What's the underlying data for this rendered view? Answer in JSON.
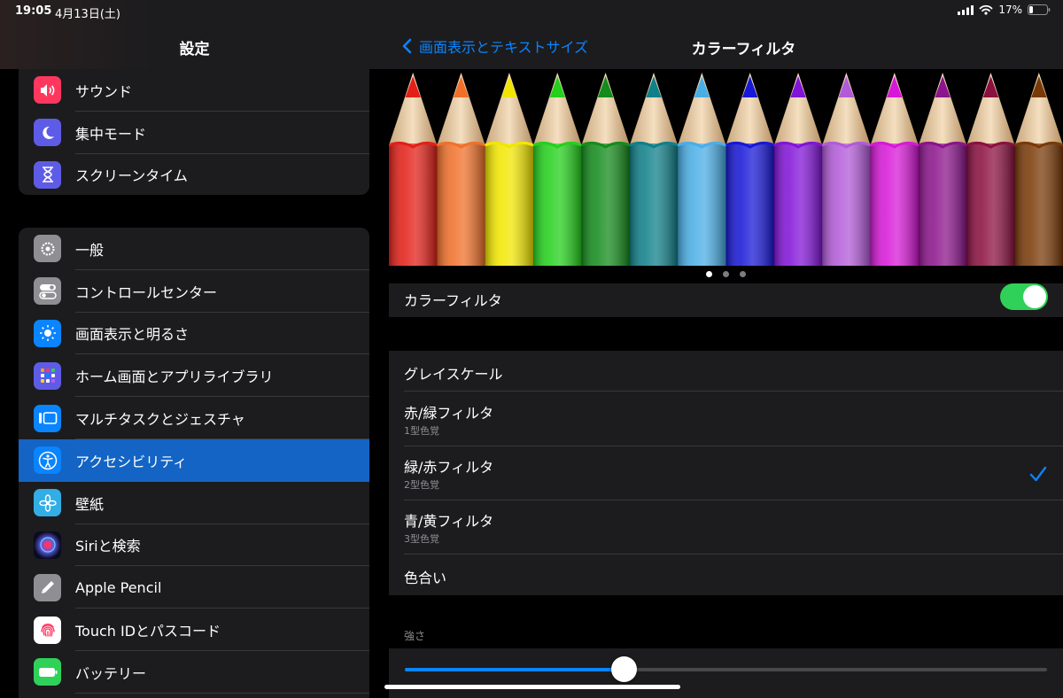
{
  "status": {
    "time": "19:05",
    "date": "4月13日(土)",
    "battery": "17%"
  },
  "sidebar": {
    "title": "設定",
    "group1": [
      {
        "label": "サウンド",
        "icon": "speaker-icon",
        "color": "#ff375f"
      },
      {
        "label": "集中モード",
        "icon": "moon-icon",
        "color": "#5e5ce6"
      },
      {
        "label": "スクリーンタイム",
        "icon": "hourglass-icon",
        "color": "#5e5ce6"
      }
    ],
    "group2": [
      {
        "label": "一般",
        "icon": "gear-icon",
        "color": "#8e8e93"
      },
      {
        "label": "コントロールセンター",
        "icon": "toggles-icon",
        "color": "#8e8e93"
      },
      {
        "label": "画面表示と明るさ",
        "icon": "sun-icon",
        "color": "#0a84ff"
      },
      {
        "label": "ホーム画面とアプリライブラリ",
        "icon": "home-grid-icon",
        "color": "#5e5ce6"
      },
      {
        "label": "マルチタスクとジェスチャ",
        "icon": "multitask-icon",
        "color": "#0a84ff"
      },
      {
        "label": "アクセシビリティ",
        "icon": "accessibility-icon",
        "color": "#0a84ff",
        "selected": true
      },
      {
        "label": "壁紙",
        "icon": "flower-icon",
        "color": "#32ade6"
      },
      {
        "label": "Siriと検索",
        "icon": "siri-icon",
        "color": "#1c1c1e"
      },
      {
        "label": "Apple Pencil",
        "icon": "pencil-icon",
        "color": "#8e8e93"
      },
      {
        "label": "Touch IDとパスコード",
        "icon": "fingerprint-icon",
        "color": "#ffffff"
      },
      {
        "label": "バッテリー",
        "icon": "battery-icon",
        "color": "#30d158"
      }
    ]
  },
  "detail": {
    "back_label": "画面表示とテキストサイズ",
    "title": "カラーフィルタ",
    "pencil_colors": [
      "#e32018",
      "#f0702a",
      "#f2e600",
      "#24d01c",
      "#148c1c",
      "#10808a",
      "#4aaee6",
      "#1818d8",
      "#8214d8",
      "#b25ad8",
      "#d818d8",
      "#8c148c",
      "#8c1040",
      "#7a3a08"
    ],
    "page_dots": 3,
    "toggle": {
      "label": "カラーフィルタ",
      "on": true,
      "color": "#30d158"
    },
    "filters": [
      {
        "title": "グレイスケール",
        "subtitle": ""
      },
      {
        "title": "赤/緑フィルタ",
        "subtitle": "1型色覚"
      },
      {
        "title": "緑/赤フィルタ",
        "subtitle": "2型色覚",
        "checked": true
      },
      {
        "title": "青/黄フィルタ",
        "subtitle": "3型色覚"
      },
      {
        "title": "色合い",
        "subtitle": ""
      }
    ],
    "strength": {
      "label": "強さ",
      "value": 0.34
    },
    "accent": "#0a84ff"
  }
}
